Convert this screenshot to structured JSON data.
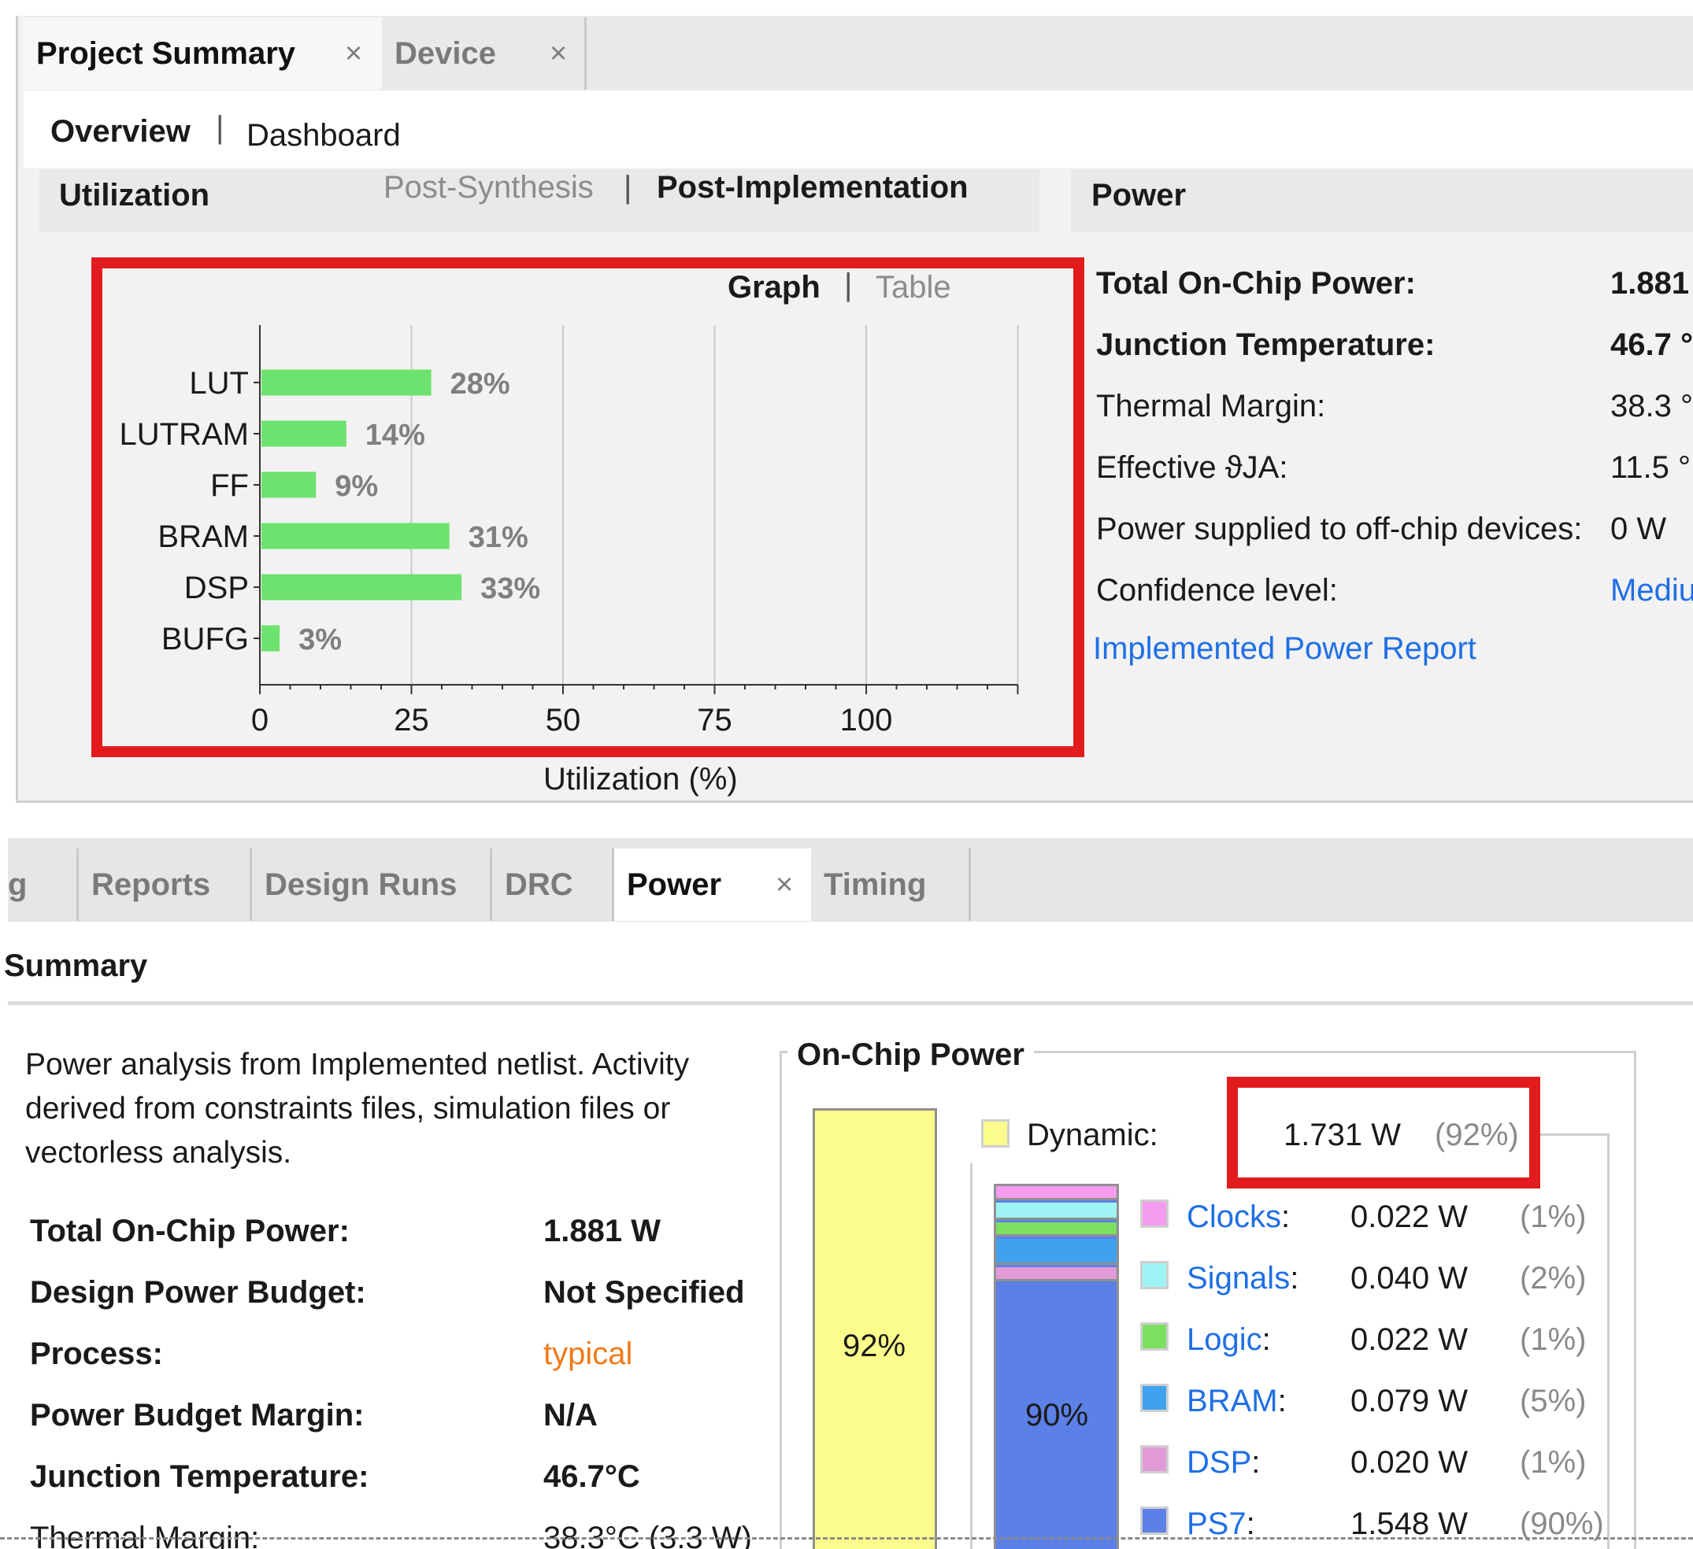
{
  "editor_tabs": [
    {
      "label": "Project Summary",
      "close": "×"
    },
    {
      "label": "Device",
      "close": "×"
    }
  ],
  "subnav": {
    "overview": "Overview",
    "dashboard": "Dashboard",
    "sep": "|"
  },
  "utilization": {
    "title": "Utilization",
    "post_synthesis": "Post-Synthesis",
    "post_implementation": "Post-Implementation",
    "view_graph": "Graph",
    "view_table": "Table"
  },
  "chart_data": {
    "type": "bar",
    "orientation": "horizontal",
    "categories": [
      "LUT",
      "LUTRAM",
      "FF",
      "BRAM",
      "DSP",
      "BUFG"
    ],
    "values": [
      28,
      14,
      9,
      31,
      33,
      3
    ],
    "value_labels": [
      "28%",
      "14%",
      "9%",
      "31%",
      "33%",
      "3%"
    ],
    "xlabel": "Utilization (%)",
    "xticks": [
      "0",
      "25",
      "50",
      "75",
      "100"
    ],
    "xlim": [
      0,
      125
    ],
    "grid": true,
    "bar_color": "#6ee26e"
  },
  "power": {
    "title": "Power",
    "rows": [
      {
        "label": "Total On-Chip Power:",
        "value": "1.881",
        "bold": true
      },
      {
        "label": "Junction Temperature:",
        "value": "46.7 °",
        "bold": true
      },
      {
        "label": "Thermal Margin:",
        "value": "38.3 °"
      },
      {
        "label": "Effective ϑJA:",
        "value": "11.5 °"
      },
      {
        "label": "Power supplied to off-chip devices:",
        "value": "0 W"
      },
      {
        "label": "Confidence level:",
        "value": "Mediu"
      }
    ],
    "report_link": "Implemented Power Report"
  },
  "bottom_tabs": [
    "g",
    "Reports",
    "Design Runs",
    "DRC",
    "Power",
    "Timing"
  ],
  "bottom_close": "×",
  "summary": {
    "title": "Summary",
    "description": "Power analysis from Implemented netlist. Activity derived from constraints files, simulation files or vectorless analysis.",
    "desc_lines": [
      "Power analysis from Implemented netlist. Activity",
      "derived from constraints files, simulation files or",
      "vectorless analysis."
    ],
    "rows": [
      {
        "label": "Total On-Chip Power:",
        "value": "1.881 W"
      },
      {
        "label": "Design Power Budget:",
        "value": "Not Specified"
      },
      {
        "label": "Process:",
        "value": "typical"
      },
      {
        "label": "Power Budget Margin:",
        "value": "N/A"
      },
      {
        "label": "Junction Temperature:",
        "value": "46.7°C"
      },
      {
        "label": "Thermal Margin:",
        "value": "38.3°C (3.3 W)"
      }
    ],
    "process_color": "#f07a1a"
  },
  "onchip": {
    "title": "On-Chip Power",
    "dynamic_label": "Dynamic:",
    "dynamic_w": "1.731 W",
    "dynamic_pct": "(92%)",
    "dynamic_bar_label": "92%",
    "ps7_bar_label": "90%",
    "components": [
      {
        "name": "Clocks",
        "watts": "0.022 W",
        "pct": "(1%)",
        "color": "#f59cf0",
        "fraction": 0.01
      },
      {
        "name": "Signals",
        "watts": "0.040 W",
        "pct": "(2%)",
        "color": "#9ef4f4",
        "fraction": 0.02
      },
      {
        "name": "Logic",
        "watts": "0.022 W",
        "pct": "(1%)",
        "color": "#7be060",
        "fraction": 0.01
      },
      {
        "name": "BRAM",
        "watts": "0.079 W",
        "pct": "(5%)",
        "color": "#3ea2ee",
        "fraction": 0.05
      },
      {
        "name": "DSP",
        "watts": "0.020 W",
        "pct": "(1%)",
        "color": "#e39ad8",
        "fraction": 0.01
      },
      {
        "name": "PS7",
        "watts": "1.548 W",
        "pct": "(90%)",
        "color": "#5b80e6",
        "fraction": 0.9
      }
    ],
    "colon": ":"
  }
}
